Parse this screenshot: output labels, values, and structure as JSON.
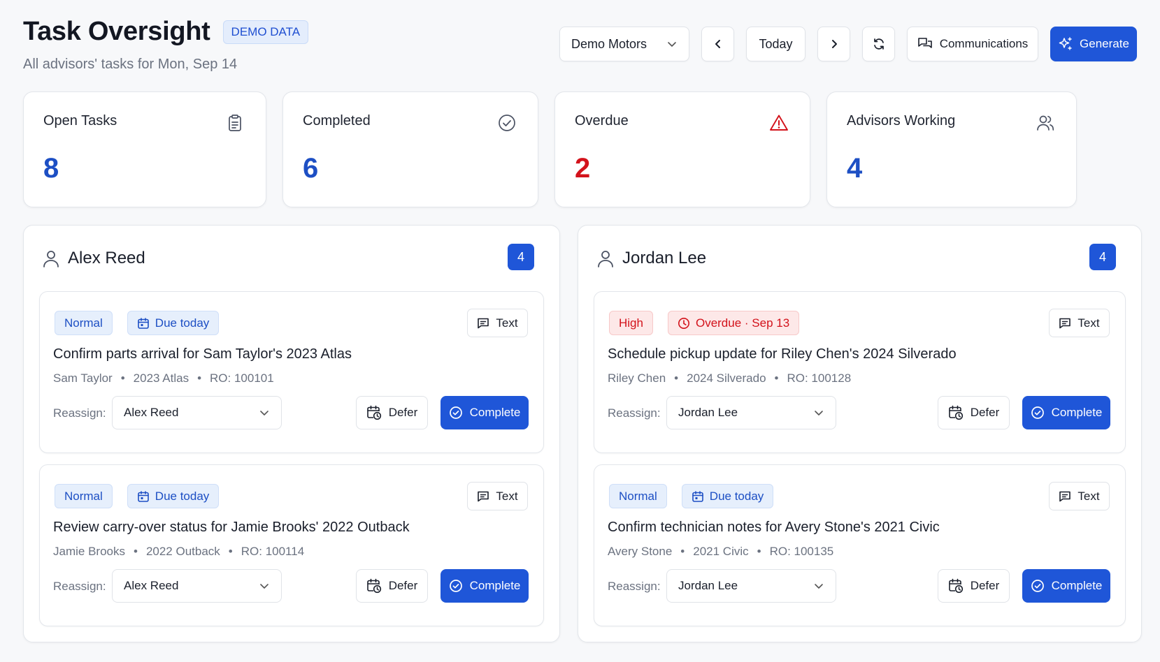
{
  "header": {
    "title": "Task Oversight",
    "badge": "DEMO DATA",
    "subtitle": "All advisors' tasks for Mon, Sep 14"
  },
  "toolbar": {
    "dealer_select": "Demo Motors",
    "today_label": "Today",
    "communications_label": "Communications",
    "generate_label": "Generate"
  },
  "stats": [
    {
      "label": "Open Tasks",
      "value": "8",
      "icon": "clipboard-icon",
      "color": "#1d4fc4"
    },
    {
      "label": "Completed",
      "value": "6",
      "icon": "check-circle-icon",
      "color": "#1d4fc4"
    },
    {
      "label": "Overdue",
      "value": "2",
      "icon": "warning-triangle-icon",
      "color": "#d3121b"
    },
    {
      "label": "Advisors Working",
      "value": "4",
      "icon": "users-icon",
      "color": "#1d4fc4"
    }
  ],
  "advisors": [
    {
      "name": "Alex Reed",
      "count": "4",
      "tasks": [
        {
          "priority": "Normal",
          "due": "Due today",
          "text_label": "Text",
          "title": "Confirm parts arrival for Sam Taylor's 2023 Atlas",
          "customer": "Sam Taylor",
          "vehicle": "2023 Atlas",
          "ro": "RO: 100101",
          "reassign_label": "Reassign:",
          "reassign_value": "Alex Reed",
          "defer_label": "Defer",
          "complete_label": "Complete"
        },
        {
          "priority": "Normal",
          "due": "Due today",
          "text_label": "Text",
          "title": "Review carry-over status for Jamie Brooks' 2022 Outback",
          "customer": "Jamie Brooks",
          "vehicle": "2022 Outback",
          "ro": "RO: 100114",
          "reassign_label": "Reassign:",
          "reassign_value": "Alex Reed",
          "defer_label": "Defer",
          "complete_label": "Complete"
        }
      ]
    },
    {
      "name": "Jordan Lee",
      "count": "4",
      "tasks": [
        {
          "priority": "High",
          "due": "Overdue · Sep 13",
          "text_label": "Text",
          "title": "Schedule pickup update for Riley Chen's 2024 Silverado",
          "customer": "Riley Chen",
          "vehicle": "2024 Silverado",
          "ro": "RO: 100128",
          "reassign_label": "Reassign:",
          "reassign_value": "Jordan Lee",
          "defer_label": "Defer",
          "complete_label": "Complete"
        },
        {
          "priority": "Normal",
          "due": "Due today",
          "text_label": "Text",
          "title": "Confirm technician notes for Avery Stone's 2021 Civic",
          "customer": "Avery Stone",
          "vehicle": "2021 Civic",
          "ro": "RO: 100135",
          "reassign_label": "Reassign:",
          "reassign_value": "Jordan Lee",
          "defer_label": "Defer",
          "complete_label": "Complete"
        }
      ]
    }
  ],
  "colors": {
    "accent": "#1f56d8",
    "danger": "#d3121b",
    "badge_bg": "#e6effc"
  }
}
